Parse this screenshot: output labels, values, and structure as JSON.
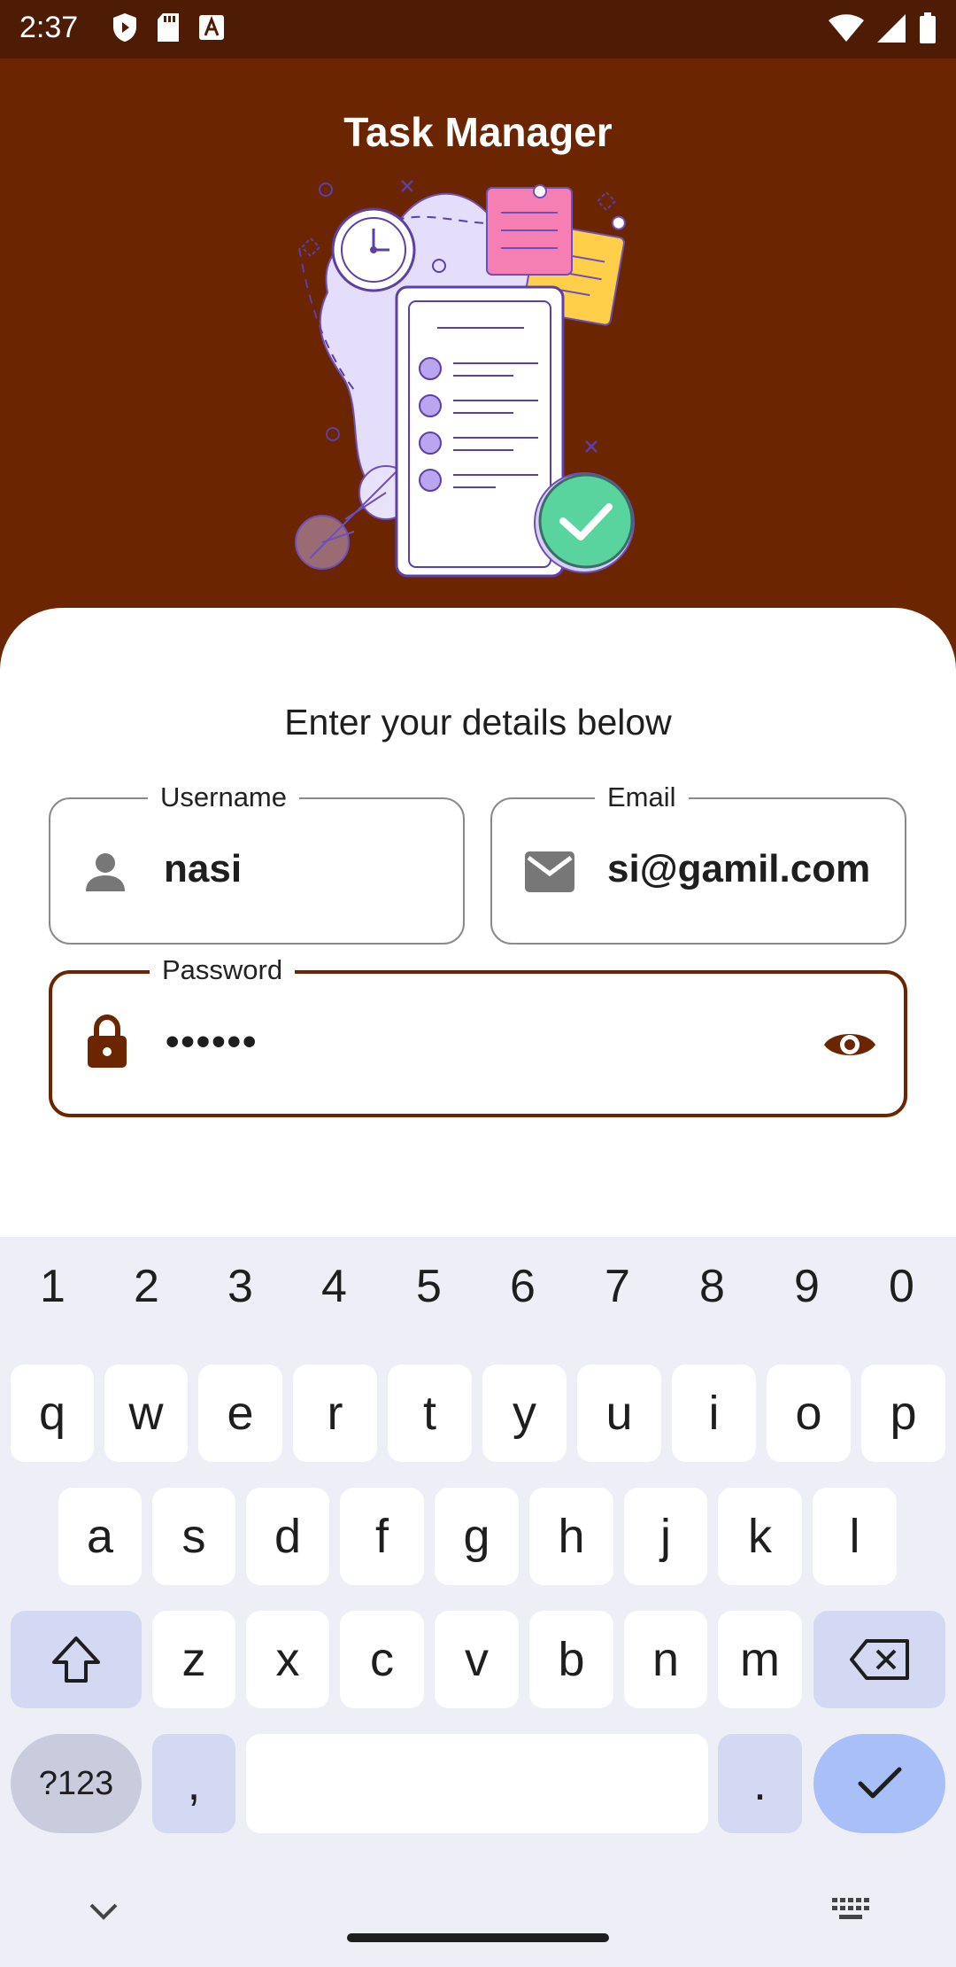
{
  "status_bar": {
    "time": "2:37"
  },
  "header": {
    "title": "Task Manager"
  },
  "form": {
    "subtitle": "Enter your details below",
    "username": {
      "label": "Username",
      "value": "nasi",
      "icon": "person-icon"
    },
    "email": {
      "label": "Email",
      "value": "si@gamil.com",
      "icon": "mail-icon"
    },
    "password": {
      "label": "Password",
      "value": "••••••",
      "icon": "lock-icon",
      "toggle_icon": "eye-icon"
    }
  },
  "keyboard": {
    "numbers": [
      "1",
      "2",
      "3",
      "4",
      "5",
      "6",
      "7",
      "8",
      "9",
      "0"
    ],
    "row1": [
      "q",
      "w",
      "e",
      "r",
      "t",
      "y",
      "u",
      "i",
      "o",
      "p"
    ],
    "row2": [
      "a",
      "s",
      "d",
      "f",
      "g",
      "h",
      "j",
      "k",
      "l"
    ],
    "row3": [
      "z",
      "x",
      "c",
      "v",
      "b",
      "n",
      "m"
    ],
    "symbols_key": "?123",
    "comma_key": ",",
    "period_key": "."
  },
  "colors": {
    "brand": "#6b2500",
    "status_bar": "#4e1c05",
    "accent_purple": "#7b5cd6",
    "check_green": "#5ad49e"
  }
}
